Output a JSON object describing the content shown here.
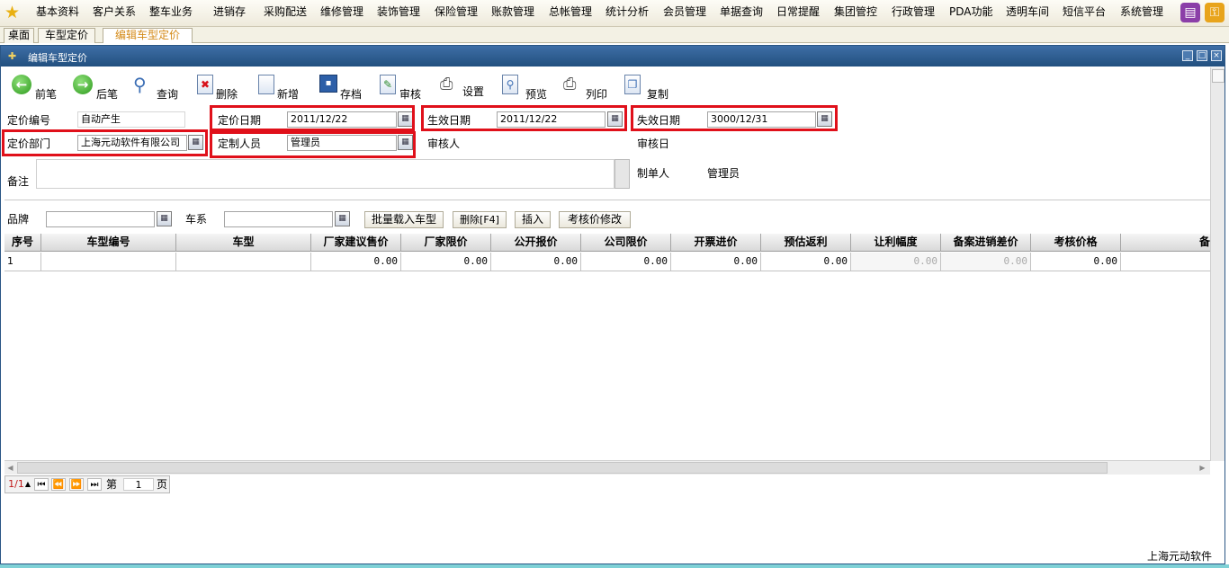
{
  "menu": {
    "items": [
      "基本资料",
      "客户关系",
      "整车业务",
      "进销存",
      "采购配送",
      "维修管理",
      "装饰管理",
      "保险管理",
      "账款管理",
      "总帐管理",
      "统计分析",
      "会员管理",
      "单据查询",
      "日常提醒",
      "集团管控",
      "行政管理",
      "PDA功能",
      "透明车间",
      "短信平台",
      "系统管理"
    ]
  },
  "tabs": [
    "桌面",
    "车型定价",
    "编辑车型定价"
  ],
  "window": {
    "title": "编辑车型定价"
  },
  "toolbar": {
    "prev": "前笔",
    "next": "后笔",
    "query": "查询",
    "delete": "删除",
    "add": "新增",
    "save": "存档",
    "audit": "审核",
    "settings": "设置",
    "preview": "预览",
    "print": "列印",
    "copy": "复制"
  },
  "form": {
    "pricing_no_label": "定价编号",
    "pricing_no_value": "自动产生",
    "pricing_date_label": "定价日期",
    "pricing_date_value": "2011/12/22",
    "effective_date_label": "生效日期",
    "effective_date_value": "2011/12/22",
    "expire_date_label": "失效日期",
    "expire_date_value": "3000/12/31",
    "dept_label": "定价部门",
    "dept_value": "上海元动软件有限公司",
    "staff_label": "定制人员",
    "staff_value": "管理员",
    "auditor_label": "审核人",
    "audit_date_label": "审核日",
    "remark_label": "备注",
    "maker_label": "制单人",
    "maker_value": "管理员"
  },
  "filter": {
    "brand_label": "品牌",
    "series_label": "车系",
    "batch_load": "批量载入车型",
    "delete_f4": "删除[F4]",
    "insert": "插入",
    "audit_modify": "考核价修改"
  },
  "grid": {
    "columns": [
      "序号",
      "车型编号",
      "车型",
      "厂家建议售价",
      "厂家限价",
      "公开报价",
      "公司限价",
      "开票进价",
      "预估返利",
      "让利幅度",
      "备案进销差价",
      "考核价格",
      "备"
    ],
    "rows": [
      [
        "1",
        "",
        "",
        "0.00",
        "0.00",
        "0.00",
        "0.00",
        "0.00",
        "0.00",
        "0.00",
        "0.00",
        "0.00",
        ""
      ]
    ]
  },
  "pager": {
    "fraction": "1/1",
    "page_label": "第",
    "page_value": "1",
    "page_unit": "页"
  },
  "status": {
    "company": "上海元动软件"
  }
}
